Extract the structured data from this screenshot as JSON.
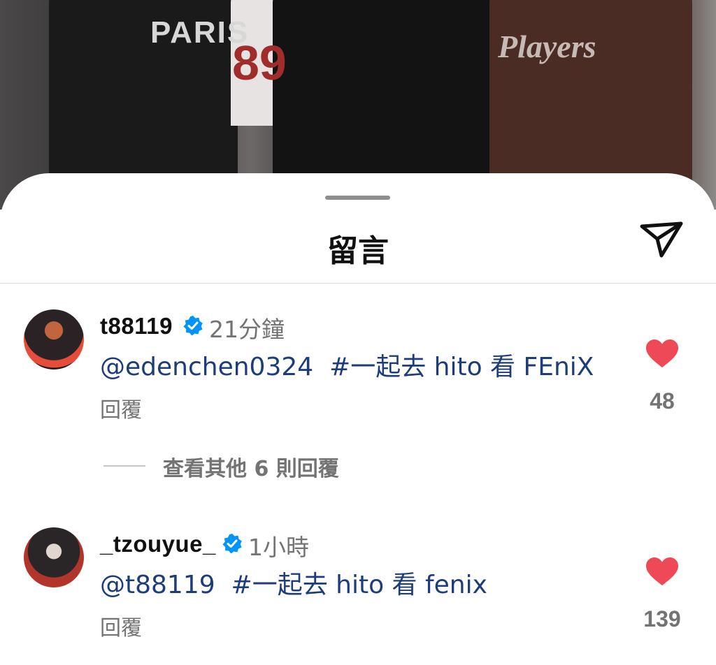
{
  "sheet": {
    "title": "留言"
  },
  "comments": [
    {
      "username": "t88119",
      "time": "21分鐘",
      "mention": "@edenchen0324",
      "hashtag": "#一起去 hito 看 FEniX",
      "reply_label": "回覆",
      "likes": "48"
    },
    {
      "username": "_tzouyue_",
      "time": "1小時",
      "mention": "@t88119",
      "hashtag": "#一起去 hito 看 fenix",
      "reply_label": "回覆",
      "likes": "139"
    }
  ],
  "view_replies": {
    "label": "查看其他 6 則回覆"
  },
  "photo": {
    "jersey_text_1": "PARIS",
    "jersey_text_2": "Players",
    "jersey_number": "89"
  },
  "colors": {
    "heart": "#ed4956",
    "verified": "#0095f6",
    "link": "#1c3d7a",
    "secondary_text": "#737373"
  },
  "icons": {
    "share": "send-icon",
    "badge": "verified-badge-icon",
    "like": "heart-icon"
  }
}
